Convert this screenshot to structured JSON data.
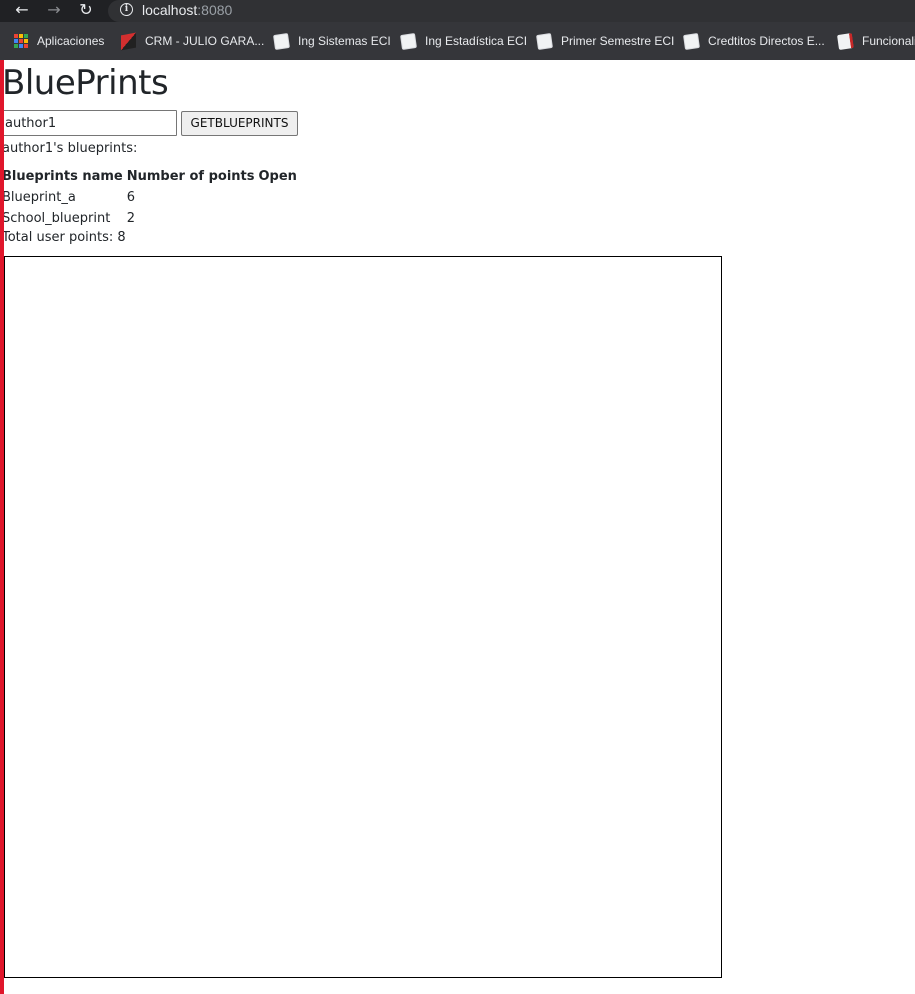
{
  "browser": {
    "url_host": "localhost",
    "url_port": ":8080"
  },
  "bookmarks": [
    {
      "label": "Aplicaciones",
      "icon": "apps-grid-icon"
    },
    {
      "label": "CRM - JULIO GARA...",
      "icon": "cube-icon"
    },
    {
      "label": "Ing Sistemas ECI",
      "icon": "document-icon"
    },
    {
      "label": "Ing Estadística ECI",
      "icon": "document-icon"
    },
    {
      "label": "Primer Semestre ECI",
      "icon": "document-icon"
    },
    {
      "label": "Credtitos Directos E...",
      "icon": "document-icon"
    },
    {
      "label": "Funcionali",
      "icon": "pdf-icon"
    }
  ],
  "page": {
    "title": "BluePrints",
    "author_input_value": "author1",
    "get_button_label": "GETBLUEPRINTS",
    "caption": "author1's blueprints:",
    "table": {
      "headers": [
        "Blueprints name",
        "Number of points",
        "Open"
      ],
      "rows": [
        {
          "name": "Blueprint_a",
          "points": "6",
          "open": ""
        },
        {
          "name": "School_blueprint",
          "points": "2",
          "open": ""
        }
      ]
    },
    "total_label": "Total user points: 8"
  },
  "colors": {
    "chrome_dark": "#202124",
    "bookmarks_bar": "#35363a",
    "left_edge_red": "#e0162b"
  }
}
